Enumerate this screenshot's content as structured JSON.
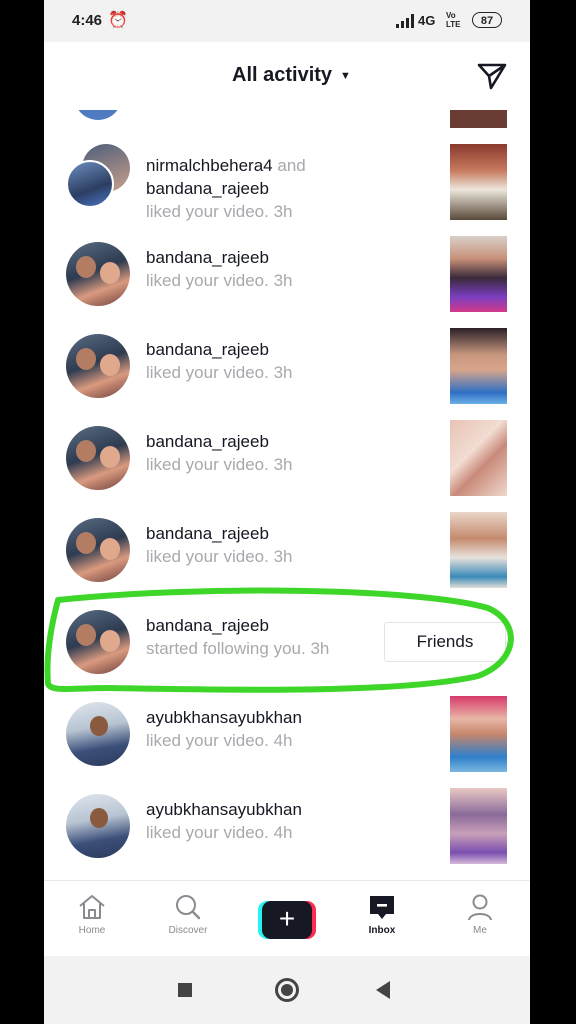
{
  "status_bar": {
    "time": "4:46",
    "network": "4G",
    "volte": "Vo LTE",
    "battery": "87"
  },
  "header": {
    "title": "All activity"
  },
  "notifications": [
    {
      "user": "nirmalchbehera4",
      "joiner": " and",
      "user2": "bandana_rajeeb",
      "action": "liked your video.",
      "time": "3h"
    },
    {
      "user": "bandana_rajeeb",
      "action": "liked your video.",
      "time": "3h"
    },
    {
      "user": "bandana_rajeeb",
      "action": "liked your video.",
      "time": "3h"
    },
    {
      "user": "bandana_rajeeb",
      "action": "liked your video.",
      "time": "3h"
    },
    {
      "user": "bandana_rajeeb",
      "action": "liked your video.",
      "time": "3h"
    },
    {
      "user": "bandana_rajeeb",
      "action": "started following you.",
      "time": "3h",
      "button": "Friends"
    },
    {
      "user": "ayubkhansayubkhan",
      "action": "liked your video.",
      "time": "4h"
    },
    {
      "user": "ayubkhansayubkhan",
      "action": "liked your video.",
      "time": "4h"
    }
  ],
  "tabs": [
    {
      "label": "Home",
      "icon": "home-icon"
    },
    {
      "label": "Discover",
      "icon": "search-icon"
    },
    {
      "label": "",
      "icon": "plus-icon"
    },
    {
      "label": "Inbox",
      "icon": "inbox-icon",
      "active": true
    },
    {
      "label": "Me",
      "icon": "person-icon"
    }
  ],
  "colors": {
    "highlight": "#3fd62a",
    "muted_text": "#a8a9ad",
    "primary_text": "#161823"
  }
}
